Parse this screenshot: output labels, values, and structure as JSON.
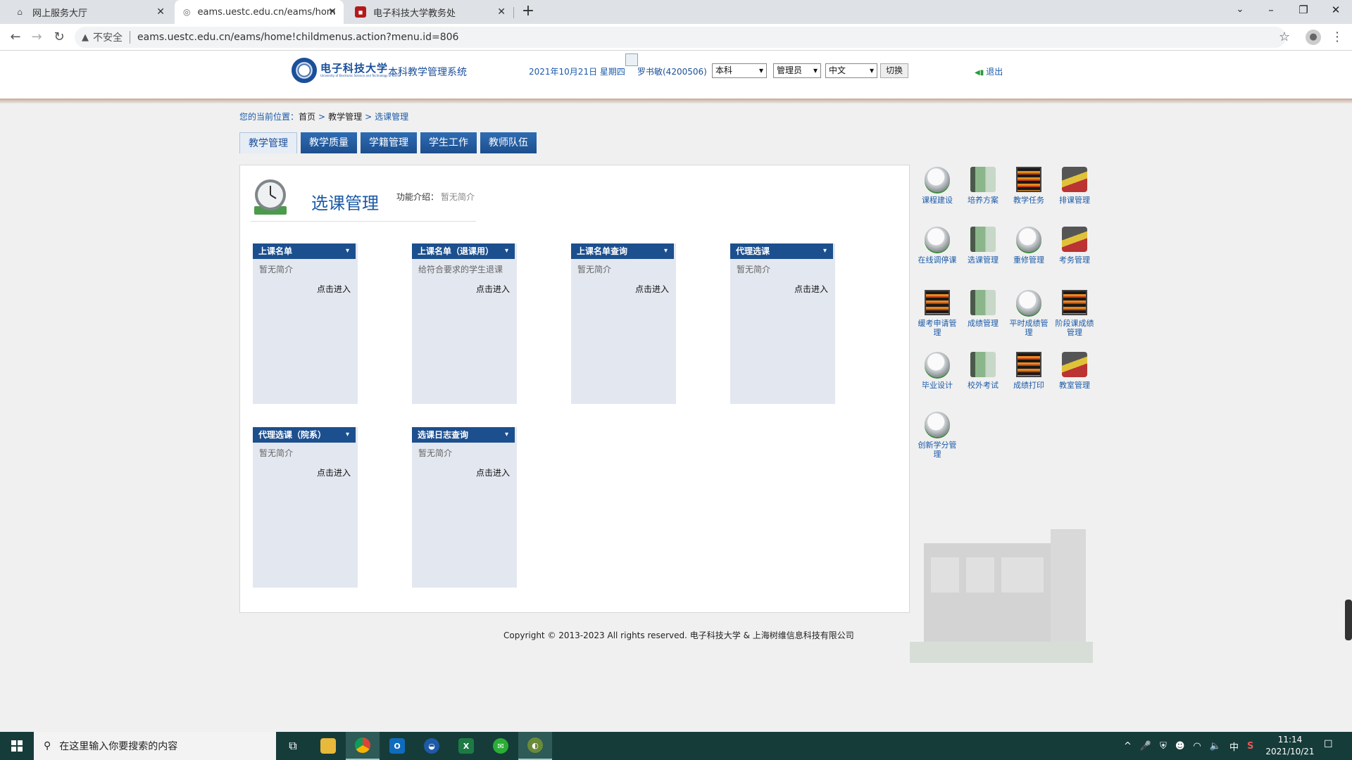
{
  "browser": {
    "tabs": [
      {
        "title": "网上服务大厅",
        "favicon": "home-icon"
      },
      {
        "title": "eams.uestc.edu.cn/eams/hom",
        "favicon": "globe-icon"
      },
      {
        "title": "电子科技大学教务处",
        "favicon": "uestc-logo-icon"
      }
    ],
    "new_tab_label": "+",
    "security_label": "不安全",
    "url": "eams.uestc.edu.cn/eams/home!childmenus.action?menu.id=806"
  },
  "header": {
    "logo_text": "电子科技大学",
    "logo_sub": "University of Electronic Science and Technology of China",
    "system_name": "本科教学管理系统",
    "date": "2021年10月21日 星期四",
    "user": "罗书敏(4200506)",
    "level_select": "本科",
    "role_select": "管理员",
    "lang_select": "中文",
    "switch_label": "切换",
    "logout_label": "退出"
  },
  "breadcrumb": {
    "prefix": "您的当前位置：",
    "items": [
      "首页",
      "教学管理",
      "选课管理"
    ],
    "sep": ">"
  },
  "nav_tabs": [
    "教学管理",
    "教学质量",
    "学籍管理",
    "学生工作",
    "教师队伍"
  ],
  "content": {
    "title": "选课管理",
    "intro_label": "功能介绍：",
    "intro_text": "暂无简介",
    "cards": [
      {
        "title": "上课名单",
        "desc": "暂无简介",
        "enter": "点击进入"
      },
      {
        "title": "上课名单（退课用）",
        "desc": "给符合要求的学生退课",
        "enter": "点击进入"
      },
      {
        "title": "上课名单查询",
        "desc": "暂无简介",
        "enter": "点击进入"
      },
      {
        "title": "代理选课",
        "desc": "暂无简介",
        "enter": "点击进入"
      },
      {
        "title": "代理选课（院系）",
        "desc": "暂无简介",
        "enter": "点击进入"
      },
      {
        "title": "选课日志查询",
        "desc": "暂无简介",
        "enter": "点击进入"
      }
    ]
  },
  "side_menu": [
    {
      "label": "课程建设",
      "icon": "clock-icon"
    },
    {
      "label": "培养方案",
      "icon": "book-icon"
    },
    {
      "label": "教学任务",
      "icon": "bars-icon"
    },
    {
      "label": "排课管理",
      "icon": "photo-icon"
    },
    {
      "label": "在线调停课",
      "icon": "clock-icon"
    },
    {
      "label": "选课管理",
      "icon": "book-icon"
    },
    {
      "label": "重修管理",
      "icon": "clock-icon"
    },
    {
      "label": "考务管理",
      "icon": "photo-icon"
    },
    {
      "label": "缓考申请管理",
      "icon": "bars-icon"
    },
    {
      "label": "成绩管理",
      "icon": "book-icon"
    },
    {
      "label": "平时成绩管理",
      "icon": "clock-icon"
    },
    {
      "label": "阶段课成绩管理",
      "icon": "bars-icon"
    },
    {
      "label": "毕业设计",
      "icon": "clock-icon"
    },
    {
      "label": "校外考试",
      "icon": "book-icon"
    },
    {
      "label": "成绩打印",
      "icon": "bars-icon"
    },
    {
      "label": "教室管理",
      "icon": "photo-icon"
    },
    {
      "label": "创新学分管理",
      "icon": "clock-icon"
    }
  ],
  "footer": "Copyright © 2013-2023 All rights reserved.  电子科技大学 & 上海树维信息科技有限公司",
  "taskbar": {
    "search_placeholder": "在这里输入你要搜索的内容",
    "time": "11:14",
    "date": "2021/10/21",
    "ime": "中"
  }
}
